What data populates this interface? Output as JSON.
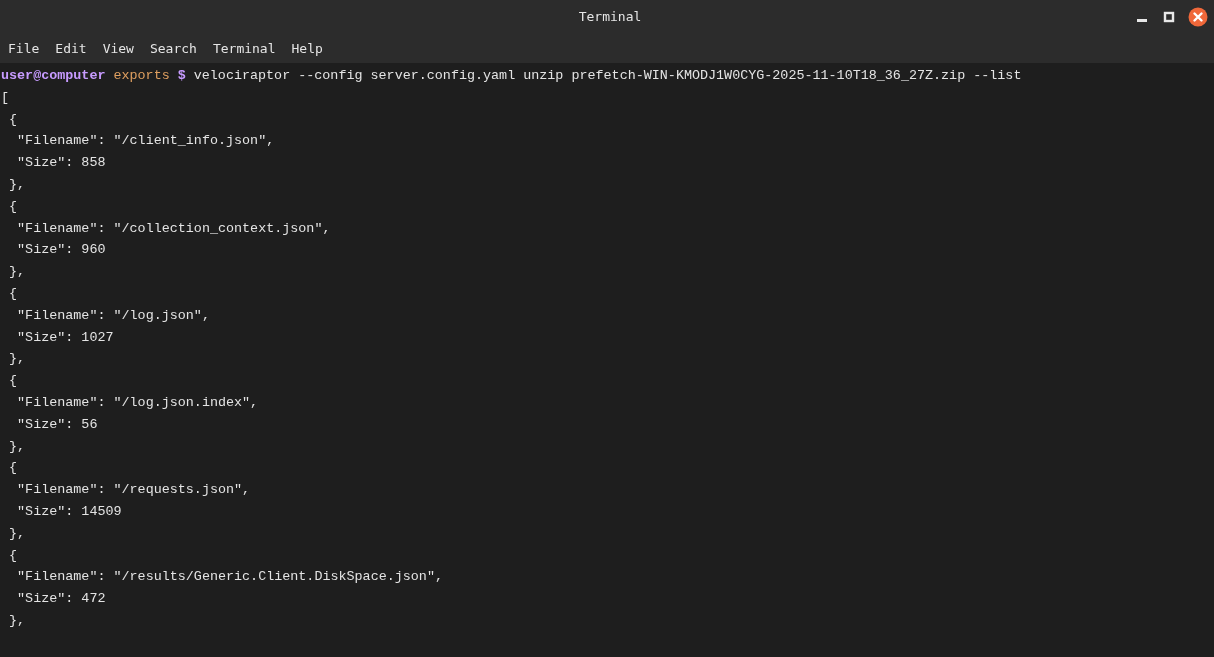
{
  "window": {
    "title": "Terminal"
  },
  "menu": [
    "File",
    "Edit",
    "View",
    "Search",
    "Terminal",
    "Help"
  ],
  "terminal": {
    "prompt": {
      "user": "user@computer",
      "directory": "exports",
      "symbol": "$",
      "command": "velociraptor --config server.config.yaml unzip prefetch-WIN-KMODJ1W0CYG-2025-11-10T18_36_27Z.zip --list"
    },
    "output": [
      "[",
      " {",
      "  \"Filename\": \"/client_info.json\",",
      "  \"Size\": 858",
      " },",
      " {",
      "  \"Filename\": \"/collection_context.json\",",
      "  \"Size\": 960",
      " },",
      " {",
      "  \"Filename\": \"/log.json\",",
      "  \"Size\": 1027",
      " },",
      " {",
      "  \"Filename\": \"/log.json.index\",",
      "  \"Size\": 56",
      " },",
      " {",
      "  \"Filename\": \"/requests.json\",",
      "  \"Size\": 14509",
      " },",
      " {",
      "  \"Filename\": \"/results/Generic.Client.DiskSpace.json\",",
      "  \"Size\": 472",
      " },"
    ]
  }
}
